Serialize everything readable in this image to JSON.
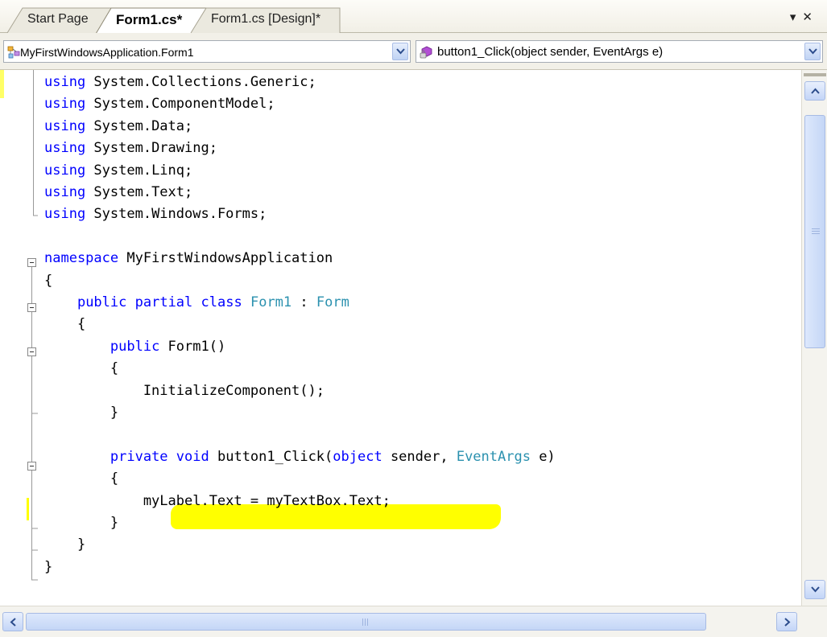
{
  "tabs": [
    {
      "label": "Start Page",
      "active": false
    },
    {
      "label": "Form1.cs*",
      "active": true
    },
    {
      "label": "Form1.cs [Design]*",
      "active": false
    }
  ],
  "window_controls": {
    "dropdown_glyph": "▾",
    "close_glyph": "✕"
  },
  "navbar": {
    "class_combo": {
      "value": "MyFirstWindowsApplication.Form1",
      "icon": "class-icon"
    },
    "member_combo": {
      "value": "button1_Click(object sender, EventArgs e)",
      "icon": "method-icon"
    }
  },
  "colors": {
    "keyword": "#0000ff",
    "type": "#2b91af",
    "text": "#000000",
    "highlight": "#ffff00",
    "change_marker": "#ffff66"
  },
  "code_lines": [
    [
      {
        "t": "kw",
        "v": "using"
      },
      {
        "t": "tx",
        "v": " System.Collections.Generic;"
      }
    ],
    [
      {
        "t": "kw",
        "v": "using"
      },
      {
        "t": "tx",
        "v": " System.ComponentModel;"
      }
    ],
    [
      {
        "t": "kw",
        "v": "using"
      },
      {
        "t": "tx",
        "v": " System.Data;"
      }
    ],
    [
      {
        "t": "kw",
        "v": "using"
      },
      {
        "t": "tx",
        "v": " System.Drawing;"
      }
    ],
    [
      {
        "t": "kw",
        "v": "using"
      },
      {
        "t": "tx",
        "v": " System.Linq;"
      }
    ],
    [
      {
        "t": "kw",
        "v": "using"
      },
      {
        "t": "tx",
        "v": " System.Text;"
      }
    ],
    [
      {
        "t": "kw",
        "v": "using"
      },
      {
        "t": "tx",
        "v": " System.Windows.Forms;"
      }
    ],
    [],
    [
      {
        "t": "kw",
        "v": "namespace"
      },
      {
        "t": "tx",
        "v": " MyFirstWindowsApplication"
      }
    ],
    [
      {
        "t": "tx",
        "v": "{"
      }
    ],
    [
      {
        "t": "tx",
        "v": "    "
      },
      {
        "t": "kw",
        "v": "public"
      },
      {
        "t": "tx",
        "v": " "
      },
      {
        "t": "kw",
        "v": "partial"
      },
      {
        "t": "tx",
        "v": " "
      },
      {
        "t": "kw",
        "v": "class"
      },
      {
        "t": "tx",
        "v": " "
      },
      {
        "t": "ty",
        "v": "Form1"
      },
      {
        "t": "tx",
        "v": " : "
      },
      {
        "t": "ty",
        "v": "Form"
      }
    ],
    [
      {
        "t": "tx",
        "v": "    {"
      }
    ],
    [
      {
        "t": "tx",
        "v": "        "
      },
      {
        "t": "kw",
        "v": "public"
      },
      {
        "t": "tx",
        "v": " Form1()"
      }
    ],
    [
      {
        "t": "tx",
        "v": "        {"
      }
    ],
    [
      {
        "t": "tx",
        "v": "            InitializeComponent();"
      }
    ],
    [
      {
        "t": "tx",
        "v": "        }"
      }
    ],
    [],
    [
      {
        "t": "tx",
        "v": "        "
      },
      {
        "t": "kw",
        "v": "private"
      },
      {
        "t": "tx",
        "v": " "
      },
      {
        "t": "kw",
        "v": "void"
      },
      {
        "t": "tx",
        "v": " button1_Click("
      },
      {
        "t": "kw",
        "v": "object"
      },
      {
        "t": "tx",
        "v": " sender, "
      },
      {
        "t": "ty",
        "v": "EventArgs"
      },
      {
        "t": "tx",
        "v": " e)"
      }
    ],
    [
      {
        "t": "tx",
        "v": "        {"
      }
    ],
    [
      {
        "t": "tx",
        "v": "            myLabel.Text = myTextBox.Text;"
      }
    ],
    [
      {
        "t": "tx",
        "v": "        }"
      }
    ],
    [
      {
        "t": "tx",
        "v": "    }"
      }
    ],
    [
      {
        "t": "tx",
        "v": "}"
      }
    ]
  ]
}
